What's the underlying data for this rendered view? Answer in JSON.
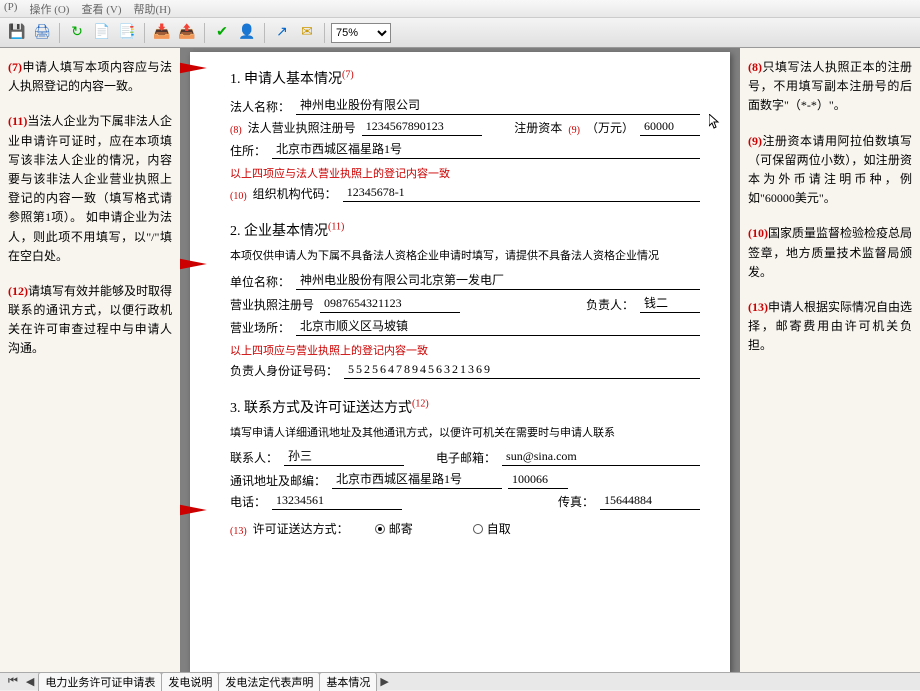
{
  "menubar": [
    "(P)",
    "操作 (O)",
    "查看 (V)",
    "帮助(H)"
  ],
  "toolbar": {
    "icons": [
      {
        "name": "save-icon",
        "glyph": "💾",
        "color": "#2a6ac0"
      },
      {
        "name": "print-icon",
        "glyph": "🖨",
        "color": "#2a6ac0"
      },
      {
        "name": "refresh-icon",
        "glyph": "↻",
        "color": "#0a0"
      },
      {
        "name": "doc-new-icon",
        "glyph": "📄",
        "color": "#0a0"
      },
      {
        "name": "doc-copy-icon",
        "glyph": "📑",
        "color": "#0a0"
      },
      {
        "name": "import-icon",
        "glyph": "📥",
        "color": "#06c"
      },
      {
        "name": "export-icon",
        "glyph": "📤",
        "color": "#06c"
      },
      {
        "name": "check-icon",
        "glyph": "✔",
        "color": "#0a0"
      },
      {
        "name": "user-icon",
        "glyph": "👤",
        "color": "#888"
      },
      {
        "name": "send-icon",
        "glyph": "↗",
        "color": "#06c"
      },
      {
        "name": "mail-icon",
        "glyph": "✉",
        "color": "#c90"
      }
    ],
    "zoom": "75%"
  },
  "left_notes": [
    {
      "num": "(7)",
      "text": "申请人填写本项内容应与法人执照登记的内容一致。"
    },
    {
      "num": "(11)",
      "text": "当法人企业为下属非法人企业申请许可证时，应在本项填写该非法人企业的情况，内容要与该非法人企业营业执照上登记的内容一致（填写格式请参照第1项）。\n如申请企业为法人，则此项不用填写，以\"/\"填在空白处。"
    },
    {
      "num": "(12)",
      "text": "请填写有效并能够及时取得联系的通讯方式，以便行政机关在许可审查过程中与申请人沟通。"
    }
  ],
  "right_notes": [
    {
      "num": "(8)",
      "text": "只填写法人执照正本的注册号，不用填写副本注册号的后面数字\"（*-*）\"。"
    },
    {
      "num": "(9)",
      "text": "注册资本请用阿拉伯数填写（可保留两位小数），如注册资本为外币请注明币种，例如\"60000美元\"。"
    },
    {
      "num": "(10)",
      "text": "国家质量监督检验检疫总局签章，地方质量技术监督局颁发。"
    },
    {
      "num": "(13)",
      "text": "申请人根据实际情况自由选择，邮寄费用由许可机关负担。"
    }
  ],
  "sec1": {
    "title": "1. 申请人基本情况",
    "sup": "(7)",
    "name_label": "法人名称：",
    "name": "神州电业股份有限公司",
    "license_sup": "(8)",
    "license_label": "法人营业执照注册号",
    "license": "1234567890123",
    "capital_label": "注册资本",
    "capital_sup": "(9)",
    "capital_unit": "（万元）",
    "capital": "60000",
    "addr_label": "住所：",
    "addr": "北京市西城区福星路1号",
    "hint": "以上四项应与法人营业执照上的登记内容一致",
    "org_sup": "(10)",
    "org_label": "组织机构代码：",
    "org": "12345678-1"
  },
  "sec2": {
    "title": "2. 企业基本情况",
    "sup": "(11)",
    "desc": "本项仅供申请人为下属不具备法人资格企业申请时填写，请提供不具备法人资格企业情况",
    "unit_label": "单位名称：",
    "unit": "神州电业股份有限公司北京第一发电厂",
    "license_label": "营业执照注册号",
    "license": "0987654321123",
    "manager_label": "负责人：",
    "manager": "钱二",
    "place_label": "营业场所：",
    "place": "北京市顺义区马坡镇",
    "hint": "以上四项应与营业执照上的登记内容一致",
    "id_label": "负责人身份证号码：",
    "id": "552564789456321369"
  },
  "sec3": {
    "title": "3. 联系方式及许可证送达方式",
    "sup": "(12)",
    "desc": "填写申请人详细通讯地址及其他通讯方式，以便许可机关在需要时与申请人联系",
    "contact_label": "联系人：",
    "contact": "孙三",
    "email_label": "电子邮箱：",
    "email": "sun@sina.com",
    "addr_label": "通讯地址及邮编：",
    "addr": "北京市西城区福星路1号",
    "zip": "100066",
    "phone_label": "电话：",
    "phone": "13234561",
    "fax_label": "传真：",
    "fax": "15644884",
    "deliver_sup": "(13)",
    "deliver_label": "许可证送达方式：",
    "opt1": "邮寄",
    "opt2": "自取"
  },
  "tabs": [
    "电力业务许可证申请表",
    "发电说明",
    "发电法定代表声明",
    "基本情况"
  ]
}
